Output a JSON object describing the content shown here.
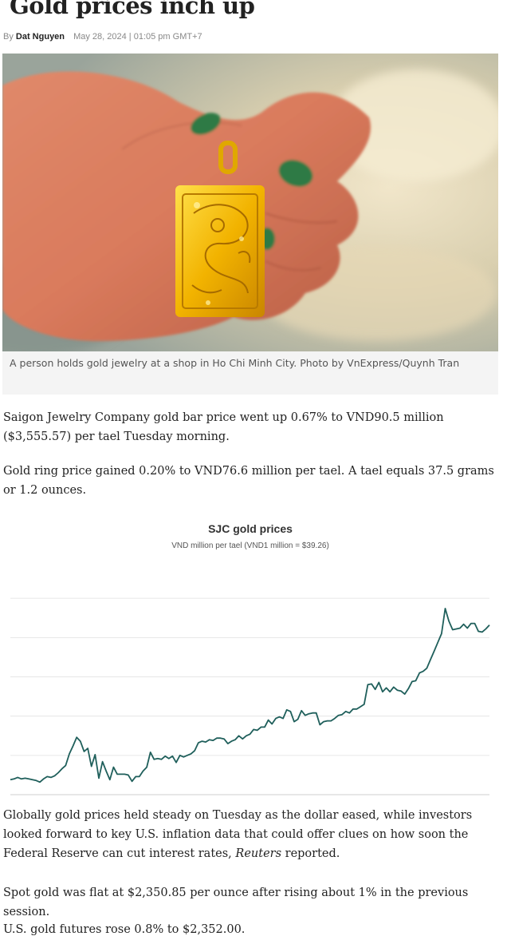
{
  "article": {
    "title": "Gold prices inch up",
    "byline_prefix": "By",
    "author": "Dat Nguyen",
    "date": "May 28, 2024 | 01:05 pm GMT+7"
  },
  "photo": {
    "caption": "A person holds gold jewelry at a shop in Ho Chi Minh City. Photo by VnExpress/Quynh Tran"
  },
  "paragraphs": {
    "p1": "Saigon Jewelry Company gold bar price went up 0.67% to VND90.5 million ($3,555.57) per tael Tuesday morning.",
    "p2": "Gold ring price gained 0.20% to VND76.6 million per tael. A tael equals 37.5 grams or 1.2 ounces.",
    "p3_before": "Globally gold prices held steady on Tuesday as the dollar eased, while investors looked forward to key U.S. inflation data that could offer clues on how soon the Federal Reserve can cut interest rates, ",
    "p3_source": "Reuters",
    "p3_after": " reported.",
    "p4": "Spot gold was flat at $2,350.85 per ounce after rising about 1% in the previous session.",
    "p5": "U.S. gold futures rose 0.8% to $2,352.00."
  },
  "chart_data": {
    "type": "line",
    "title": "SJC gold prices",
    "subtitle": "VND million per tael (VND1 million = $39.26)",
    "grid": true,
    "ylim": [
      65,
      95
    ],
    "line_color": "#1f5f5b",
    "values": [
      66.9,
      67,
      67.2,
      67,
      67.1,
      67,
      66.9,
      66.8,
      66.6,
      67,
      67.3,
      67.2,
      67.4,
      67.8,
      68.3,
      68.7,
      70.2,
      71.2,
      72.3,
      71.8,
      70.5,
      70.9,
      68.6,
      70.1,
      67.1,
      69.2,
      68,
      66.9,
      68.5,
      67.6,
      67.6,
      67.6,
      67.5,
      66.7,
      67.3,
      67.3,
      68,
      68.5,
      70.4,
      69.5,
      69.6,
      69.5,
      69.9,
      69.6,
      69.9,
      69.1,
      70,
      69.8,
      70,
      70.2,
      70.6,
      71.6,
      71.8,
      71.7,
      72,
      71.9,
      72.2,
      72.2,
      72.1,
      71.5,
      71.8,
      72,
      72.5,
      72.1,
      72.5,
      72.7,
      73.3,
      73.2,
      73.6,
      73.6,
      74.5,
      74,
      74.7,
      74.9,
      74.7,
      75.8,
      75.6,
      74.3,
      74.6,
      75.7,
      75.1,
      75.3,
      75.4,
      75.4,
      73.9,
      74.3,
      74.4,
      74.4,
      74.7,
      75.1,
      75.2,
      75.6,
      75.4,
      75.9,
      75.9,
      76.2,
      76.5,
      79,
      79.1,
      78.4,
      79.3,
      78.1,
      78.6,
      78.1,
      78.7,
      78.3,
      78.2,
      77.8,
      78.5,
      79.4,
      79.5,
      80.5,
      80.7,
      81.1,
      82.2,
      83.3,
      84.4,
      85.5,
      88.7,
      87.1,
      86,
      86.1,
      86.2,
      86.7,
      86.2,
      86.8,
      86.8,
      85.8,
      85.7,
      86.1,
      86.6
    ],
    "baseline": 60
  }
}
